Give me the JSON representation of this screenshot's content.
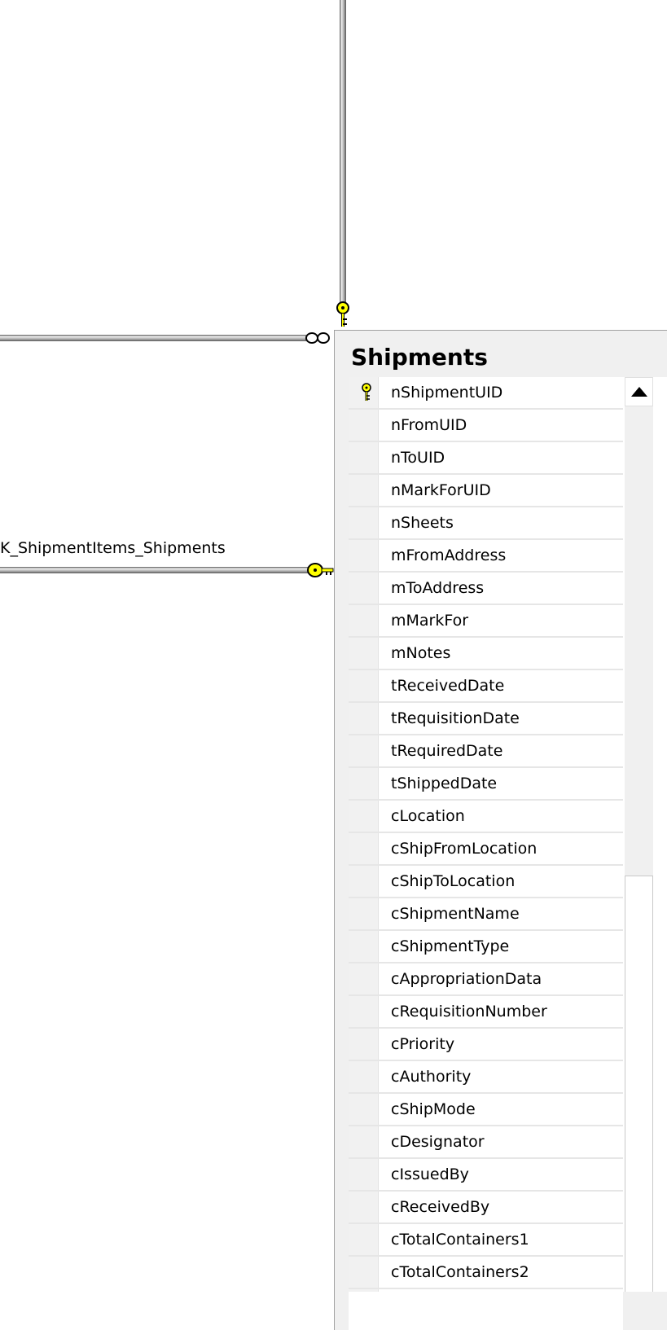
{
  "relationship": {
    "label": "K_ShipmentItems_Shipments"
  },
  "table": {
    "title": "Shipments",
    "columns": [
      {
        "name": "nShipmentUID",
        "primary_key": true
      },
      {
        "name": "nFromUID",
        "primary_key": false
      },
      {
        "name": "nToUID",
        "primary_key": false
      },
      {
        "name": "nMarkForUID",
        "primary_key": false
      },
      {
        "name": "nSheets",
        "primary_key": false
      },
      {
        "name": "mFromAddress",
        "primary_key": false
      },
      {
        "name": "mToAddress",
        "primary_key": false
      },
      {
        "name": "mMarkFor",
        "primary_key": false
      },
      {
        "name": "mNotes",
        "primary_key": false
      },
      {
        "name": "tReceivedDate",
        "primary_key": false
      },
      {
        "name": "tRequisitionDate",
        "primary_key": false
      },
      {
        "name": "tRequiredDate",
        "primary_key": false
      },
      {
        "name": "tShippedDate",
        "primary_key": false
      },
      {
        "name": "cLocation",
        "primary_key": false
      },
      {
        "name": "cShipFromLocation",
        "primary_key": false
      },
      {
        "name": "cShipToLocation",
        "primary_key": false
      },
      {
        "name": "cShipmentName",
        "primary_key": false
      },
      {
        "name": "cShipmentType",
        "primary_key": false
      },
      {
        "name": "cAppropriationData",
        "primary_key": false
      },
      {
        "name": "cRequisitionNumber",
        "primary_key": false
      },
      {
        "name": "cPriority",
        "primary_key": false
      },
      {
        "name": "cAuthority",
        "primary_key": false
      },
      {
        "name": "cShipMode",
        "primary_key": false
      },
      {
        "name": "cDesignator",
        "primary_key": false
      },
      {
        "name": "cIssuedBy",
        "primary_key": false
      },
      {
        "name": "cReceivedBy",
        "primary_key": false
      },
      {
        "name": "cTotalContainers1",
        "primary_key": false
      },
      {
        "name": "cTotalContainers2",
        "primary_key": false
      },
      {
        "name": "",
        "primary_key": false
      }
    ]
  },
  "icons": {
    "key": "key-icon",
    "infinity": "infinity-icon",
    "scroll_up": "triangle-up-icon"
  },
  "colors": {
    "key_fill": "#ffff00",
    "line_dark": "#6a6a6a",
    "table_bg": "#f0f0f0"
  }
}
